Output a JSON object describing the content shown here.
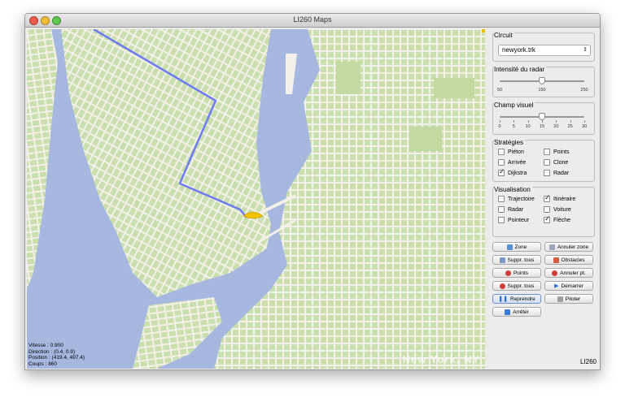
{
  "window": {
    "title": "LI260 Maps"
  },
  "map": {
    "watermark": "New York, NY",
    "status": {
      "speed": "Vitesse : 0.900",
      "direction": "Direction : (0.4, 0.9)",
      "position": "Position : (419.4, 497.4)",
      "moves": "Coups : 860"
    }
  },
  "panel": {
    "circuit": {
      "legend": "Circuit",
      "selected": "newyork.trk"
    },
    "radar": {
      "legend": "Intensité du radar",
      "min": "50",
      "mid": "150",
      "max": "250",
      "value": 150,
      "range": [
        50,
        250
      ]
    },
    "field": {
      "legend": "Champ visuel",
      "ticks": [
        "0",
        "5",
        "10",
        "15",
        "20",
        "25",
        "30"
      ],
      "value": 15,
      "range": [
        0,
        30
      ]
    },
    "strategies": {
      "legend": "Stratégies",
      "items": [
        {
          "label": "Piéton",
          "checked": false
        },
        {
          "label": "Points",
          "checked": false
        },
        {
          "label": "Arrivée",
          "checked": false
        },
        {
          "label": "Clone",
          "checked": false
        },
        {
          "label": "Dijkstra",
          "checked": true
        },
        {
          "label": "Radar",
          "checked": false
        }
      ]
    },
    "visualisation": {
      "legend": "Visualisation",
      "items": [
        {
          "label": "Trajectoire",
          "checked": false
        },
        {
          "label": "Itinéraire",
          "checked": true
        },
        {
          "label": "Radar",
          "checked": false
        },
        {
          "label": "Voiture",
          "checked": false
        },
        {
          "label": "Pointeur",
          "checked": false
        },
        {
          "label": "Flèche",
          "checked": true
        }
      ]
    },
    "buttons": {
      "zone": "Zone",
      "cancel_zone": "Annuler zone",
      "delete_all_1": "Suppr. tous",
      "obstacles": "Obstacles",
      "points": "Points",
      "cancel_point": "Annuler pt.",
      "delete_all_2": "Suppr. tous",
      "start": "Démarrer",
      "resume": "Reprendre",
      "drive": "Piloter",
      "stop": "Arrêter"
    },
    "brand": "LI260"
  },
  "colors": {
    "water": "#a6b8e0",
    "land": "#f3f1ea",
    "park": "#c9dfae",
    "route": "#6d7bf0",
    "car": "#f2c100"
  }
}
